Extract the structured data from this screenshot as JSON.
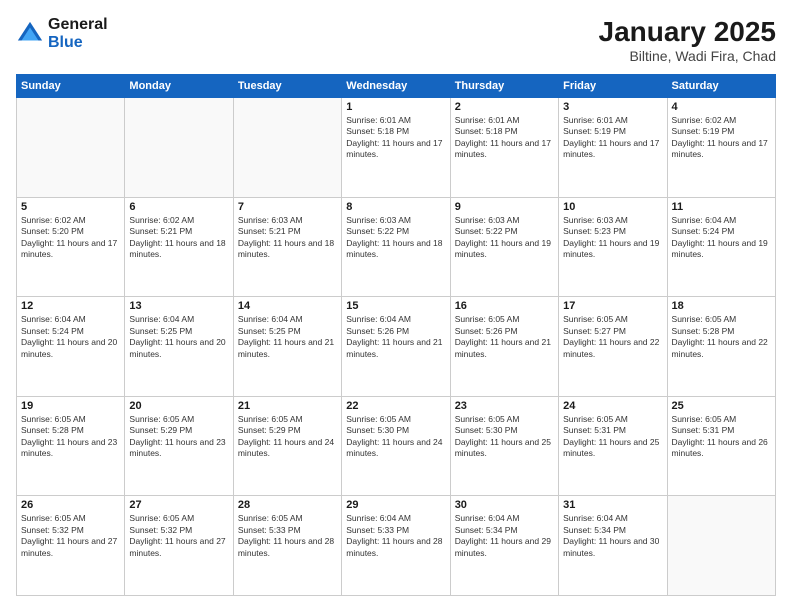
{
  "logo": {
    "general": "General",
    "blue": "Blue"
  },
  "title": "January 2025",
  "subtitle": "Biltine, Wadi Fira, Chad",
  "days_header": [
    "Sunday",
    "Monday",
    "Tuesday",
    "Wednesday",
    "Thursday",
    "Friday",
    "Saturday"
  ],
  "weeks": [
    [
      {
        "day": "",
        "sunrise": "",
        "sunset": "",
        "daylight": ""
      },
      {
        "day": "",
        "sunrise": "",
        "sunset": "",
        "daylight": ""
      },
      {
        "day": "",
        "sunrise": "",
        "sunset": "",
        "daylight": ""
      },
      {
        "day": "1",
        "sunrise": "Sunrise: 6:01 AM",
        "sunset": "Sunset: 5:18 PM",
        "daylight": "Daylight: 11 hours and 17 minutes."
      },
      {
        "day": "2",
        "sunrise": "Sunrise: 6:01 AM",
        "sunset": "Sunset: 5:18 PM",
        "daylight": "Daylight: 11 hours and 17 minutes."
      },
      {
        "day": "3",
        "sunrise": "Sunrise: 6:01 AM",
        "sunset": "Sunset: 5:19 PM",
        "daylight": "Daylight: 11 hours and 17 minutes."
      },
      {
        "day": "4",
        "sunrise": "Sunrise: 6:02 AM",
        "sunset": "Sunset: 5:19 PM",
        "daylight": "Daylight: 11 hours and 17 minutes."
      }
    ],
    [
      {
        "day": "5",
        "sunrise": "Sunrise: 6:02 AM",
        "sunset": "Sunset: 5:20 PM",
        "daylight": "Daylight: 11 hours and 17 minutes."
      },
      {
        "day": "6",
        "sunrise": "Sunrise: 6:02 AM",
        "sunset": "Sunset: 5:21 PM",
        "daylight": "Daylight: 11 hours and 18 minutes."
      },
      {
        "day": "7",
        "sunrise": "Sunrise: 6:03 AM",
        "sunset": "Sunset: 5:21 PM",
        "daylight": "Daylight: 11 hours and 18 minutes."
      },
      {
        "day": "8",
        "sunrise": "Sunrise: 6:03 AM",
        "sunset": "Sunset: 5:22 PM",
        "daylight": "Daylight: 11 hours and 18 minutes."
      },
      {
        "day": "9",
        "sunrise": "Sunrise: 6:03 AM",
        "sunset": "Sunset: 5:22 PM",
        "daylight": "Daylight: 11 hours and 19 minutes."
      },
      {
        "day": "10",
        "sunrise": "Sunrise: 6:03 AM",
        "sunset": "Sunset: 5:23 PM",
        "daylight": "Daylight: 11 hours and 19 minutes."
      },
      {
        "day": "11",
        "sunrise": "Sunrise: 6:04 AM",
        "sunset": "Sunset: 5:24 PM",
        "daylight": "Daylight: 11 hours and 19 minutes."
      }
    ],
    [
      {
        "day": "12",
        "sunrise": "Sunrise: 6:04 AM",
        "sunset": "Sunset: 5:24 PM",
        "daylight": "Daylight: 11 hours and 20 minutes."
      },
      {
        "day": "13",
        "sunrise": "Sunrise: 6:04 AM",
        "sunset": "Sunset: 5:25 PM",
        "daylight": "Daylight: 11 hours and 20 minutes."
      },
      {
        "day": "14",
        "sunrise": "Sunrise: 6:04 AM",
        "sunset": "Sunset: 5:25 PM",
        "daylight": "Daylight: 11 hours and 21 minutes."
      },
      {
        "day": "15",
        "sunrise": "Sunrise: 6:04 AM",
        "sunset": "Sunset: 5:26 PM",
        "daylight": "Daylight: 11 hours and 21 minutes."
      },
      {
        "day": "16",
        "sunrise": "Sunrise: 6:05 AM",
        "sunset": "Sunset: 5:26 PM",
        "daylight": "Daylight: 11 hours and 21 minutes."
      },
      {
        "day": "17",
        "sunrise": "Sunrise: 6:05 AM",
        "sunset": "Sunset: 5:27 PM",
        "daylight": "Daylight: 11 hours and 22 minutes."
      },
      {
        "day": "18",
        "sunrise": "Sunrise: 6:05 AM",
        "sunset": "Sunset: 5:28 PM",
        "daylight": "Daylight: 11 hours and 22 minutes."
      }
    ],
    [
      {
        "day": "19",
        "sunrise": "Sunrise: 6:05 AM",
        "sunset": "Sunset: 5:28 PM",
        "daylight": "Daylight: 11 hours and 23 minutes."
      },
      {
        "day": "20",
        "sunrise": "Sunrise: 6:05 AM",
        "sunset": "Sunset: 5:29 PM",
        "daylight": "Daylight: 11 hours and 23 minutes."
      },
      {
        "day": "21",
        "sunrise": "Sunrise: 6:05 AM",
        "sunset": "Sunset: 5:29 PM",
        "daylight": "Daylight: 11 hours and 24 minutes."
      },
      {
        "day": "22",
        "sunrise": "Sunrise: 6:05 AM",
        "sunset": "Sunset: 5:30 PM",
        "daylight": "Daylight: 11 hours and 24 minutes."
      },
      {
        "day": "23",
        "sunrise": "Sunrise: 6:05 AM",
        "sunset": "Sunset: 5:30 PM",
        "daylight": "Daylight: 11 hours and 25 minutes."
      },
      {
        "day": "24",
        "sunrise": "Sunrise: 6:05 AM",
        "sunset": "Sunset: 5:31 PM",
        "daylight": "Daylight: 11 hours and 25 minutes."
      },
      {
        "day": "25",
        "sunrise": "Sunrise: 6:05 AM",
        "sunset": "Sunset: 5:31 PM",
        "daylight": "Daylight: 11 hours and 26 minutes."
      }
    ],
    [
      {
        "day": "26",
        "sunrise": "Sunrise: 6:05 AM",
        "sunset": "Sunset: 5:32 PM",
        "daylight": "Daylight: 11 hours and 27 minutes."
      },
      {
        "day": "27",
        "sunrise": "Sunrise: 6:05 AM",
        "sunset": "Sunset: 5:32 PM",
        "daylight": "Daylight: 11 hours and 27 minutes."
      },
      {
        "day": "28",
        "sunrise": "Sunrise: 6:05 AM",
        "sunset": "Sunset: 5:33 PM",
        "daylight": "Daylight: 11 hours and 28 minutes."
      },
      {
        "day": "29",
        "sunrise": "Sunrise: 6:04 AM",
        "sunset": "Sunset: 5:33 PM",
        "daylight": "Daylight: 11 hours and 28 minutes."
      },
      {
        "day": "30",
        "sunrise": "Sunrise: 6:04 AM",
        "sunset": "Sunset: 5:34 PM",
        "daylight": "Daylight: 11 hours and 29 minutes."
      },
      {
        "day": "31",
        "sunrise": "Sunrise: 6:04 AM",
        "sunset": "Sunset: 5:34 PM",
        "daylight": "Daylight: 11 hours and 30 minutes."
      },
      {
        "day": "",
        "sunrise": "",
        "sunset": "",
        "daylight": ""
      }
    ]
  ]
}
